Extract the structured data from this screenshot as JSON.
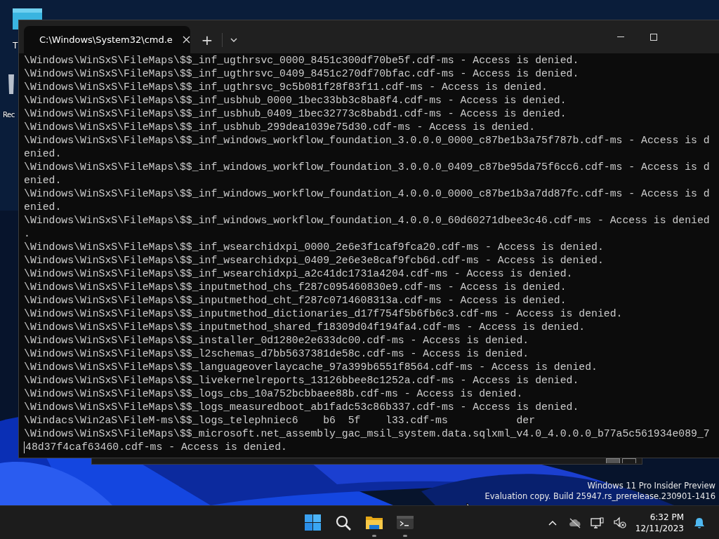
{
  "desktop": {
    "icons": [
      {
        "label": "T",
        "kind": "folder"
      },
      {
        "label": "Rec",
        "kind": "bin"
      }
    ],
    "watermark": [
      "Windows 11 Pro Insider Preview",
      "Evaluation copy. Build 25947.rs_prerelease.230901-1416"
    ]
  },
  "window": {
    "tabs": [
      {
        "title": "C:\\Windows\\System32\\cmd.e",
        "selected": true
      }
    ],
    "new_tab": "+",
    "terminal": {
      "lines": [
        "\\Windows\\WinSxS\\FileMaps\\$$_inf_ugthrsvc_0000_8451c300df70be5f.cdf-ms - Access is denied.",
        "\\Windows\\WinSxS\\FileMaps\\$$_inf_ugthrsvc_0409_8451c270df70bfac.cdf-ms - Access is denied.",
        "\\Windows\\WinSxS\\FileMaps\\$$_inf_ugthrsvc_9c5b081f28f83f11.cdf-ms - Access is denied.",
        "\\Windows\\WinSxS\\FileMaps\\$$_inf_usbhub_0000_1bec33bb3c8ba8f4.cdf-ms - Access is denied.",
        "\\Windows\\WinSxS\\FileMaps\\$$_inf_usbhub_0409_1bec32773c8babd1.cdf-ms - Access is denied.",
        "\\Windows\\WinSxS\\FileMaps\\$$_inf_usbhub_299dea1039e75d30.cdf-ms - Access is denied.",
        "\\Windows\\WinSxS\\FileMaps\\$$_inf_windows_workflow_foundation_3.0.0.0_0000_c87be1b3a75f787b.cdf-ms - Access is d",
        "enied.",
        "\\Windows\\WinSxS\\FileMaps\\$$_inf_windows_workflow_foundation_3.0.0.0_0409_c87be95da75f6cc6.cdf-ms - Access is d",
        "enied.",
        "\\Windows\\WinSxS\\FileMaps\\$$_inf_windows_workflow_foundation_4.0.0.0_0000_c87be1b3a7dd87fc.cdf-ms - Access is d",
        "enied.",
        "\\Windows\\WinSxS\\FileMaps\\$$_inf_windows_workflow_foundation_4.0.0.0_60d60271dbee3c46.cdf-ms - Access is denied",
        ".",
        "\\Windows\\WinSxS\\FileMaps\\$$_inf_wsearchidxpi_0000_2e6e3f1caf9fca20.cdf-ms - Access is denied.",
        "\\Windows\\WinSxS\\FileMaps\\$$_inf_wsearchidxpi_0409_2e6e3e8caf9fcb6d.cdf-ms - Access is denied.",
        "\\Windows\\WinSxS\\FileMaps\\$$_inf_wsearchidxpi_a2c41dc1731a4204.cdf-ms - Access is denied.",
        "\\Windows\\WinSxS\\FileMaps\\$$_inputmethod_chs_f287c095460830e9.cdf-ms - Access is denied.",
        "\\Windows\\WinSxS\\FileMaps\\$$_inputmethod_cht_f287c0714608313a.cdf-ms - Access is denied.",
        "\\Windows\\WinSxS\\FileMaps\\$$_inputmethod_dictionaries_d17f754f5b6fb6c3.cdf-ms - Access is denied.",
        "\\Windows\\WinSxS\\FileMaps\\$$_inputmethod_shared_f18309d04f194fa4.cdf-ms - Access is denied.",
        "\\Windows\\WinSxS\\FileMaps\\$$_installer_0d1280e2e633dc00.cdf-ms - Access is denied.",
        "\\Windows\\WinSxS\\FileMaps\\$$_l2schemas_d7bb5637381de58c.cdf-ms - Access is denied.",
        "\\Windows\\WinSxS\\FileMaps\\$$_languageoverlaycache_97a399b6551f8564.cdf-ms - Access is denied.",
        "\\Windows\\WinSxS\\FileMaps\\$$_livekernelreports_13126bbee8c1252a.cdf-ms - Access is denied.",
        "\\Windows\\WinSxS\\FileMaps\\$$_logs_cbs_10a752bcbbaee88b.cdf-ms - Access is denied.",
        "\\Windows\\WinSxS\\FileMaps\\$$_logs_measuredboot_ab1fadc53c86b337.cdf-ms - Access is denied.",
        "\\Windacs\\Win2aS\\FileM-ms\\$$_logs_telephniec6    b6  5f    l33.cdf-ms           der",
        "\\Windows\\WinSxS\\FileMaps\\$$_microsoft.net_assembly_gac_msil_system.data.sqlxml_v4.0_4.0.0.0_b77a5c561934e089_7",
        "48d37f4caf63460.cdf-ms - Access is denied."
      ],
      "cursor_on_last_line": true
    }
  },
  "taskbar": {
    "apps": [
      {
        "kind": "start",
        "running": false
      },
      {
        "kind": "search",
        "running": false
      },
      {
        "kind": "files",
        "running": true
      },
      {
        "kind": "terminal",
        "running": true
      }
    ],
    "tray": [
      {
        "kind": "chevron"
      },
      {
        "kind": "cloud"
      },
      {
        "kind": "network"
      },
      {
        "kind": "sound"
      }
    ],
    "time": "6:32 PM",
    "date": "12/11/2023"
  }
}
